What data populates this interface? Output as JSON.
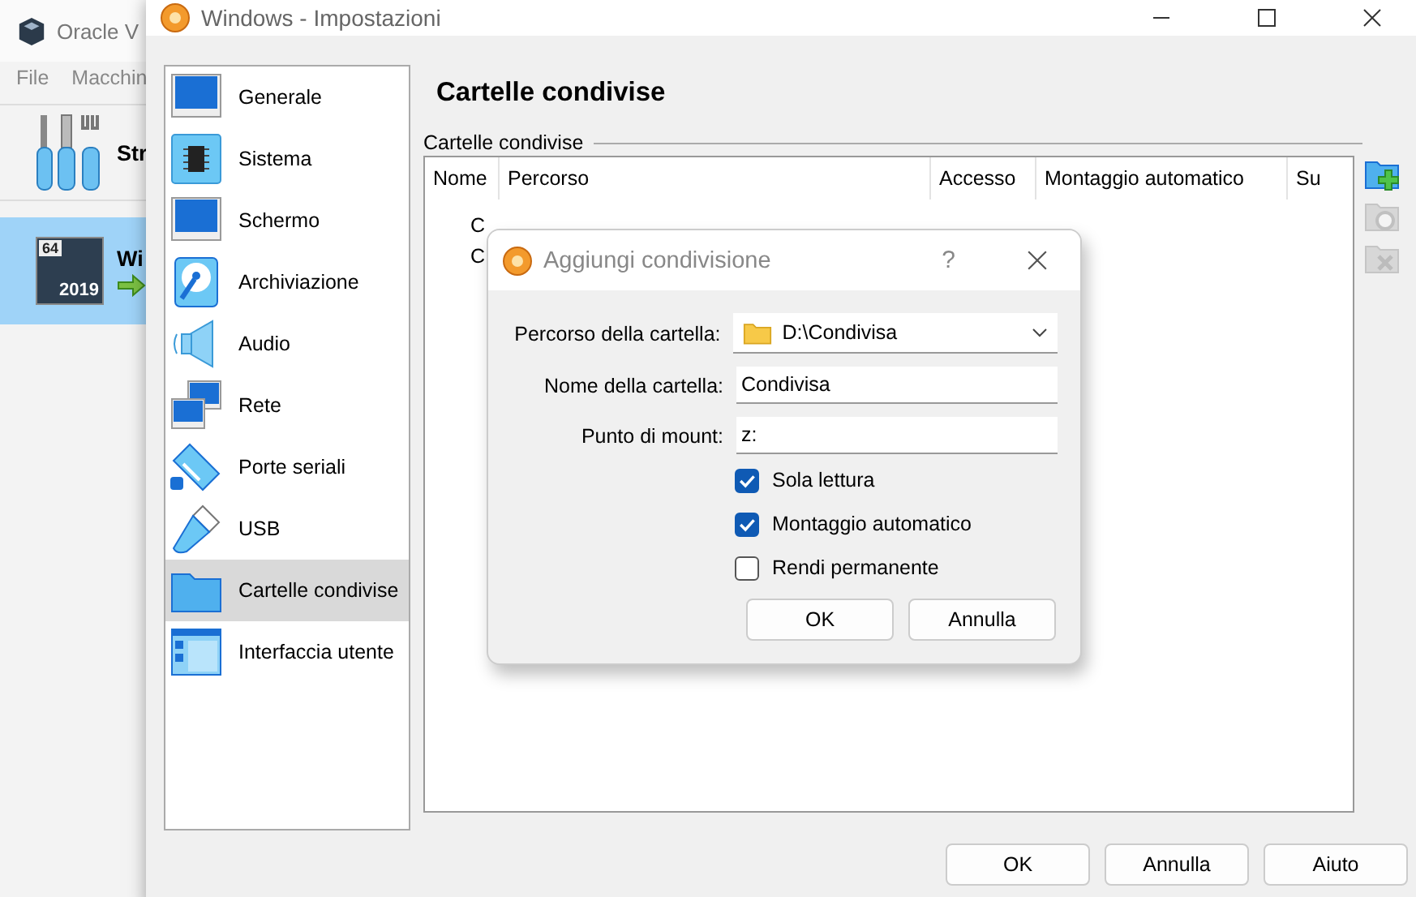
{
  "main_window": {
    "title": "Oracle V",
    "menu": [
      "File",
      "Macchin"
    ],
    "tools_label": "Str",
    "vms": [
      {
        "label": "Wi",
        "badge": "64",
        "year": "2019",
        "selected": true
      }
    ]
  },
  "settings": {
    "title": "Windows - Impostazioni",
    "sections": [
      {
        "label": "Generale",
        "kind": "monitor",
        "selected": false
      },
      {
        "label": "Sistema",
        "kind": "chip",
        "selected": false
      },
      {
        "label": "Schermo",
        "kind": "monitor",
        "selected": false
      },
      {
        "label": "Archiviazione",
        "kind": "disk",
        "selected": false
      },
      {
        "label": "Audio",
        "kind": "speaker",
        "selected": false
      },
      {
        "label": "Rete",
        "kind": "network",
        "selected": false
      },
      {
        "label": "Porte seriali",
        "kind": "serial",
        "selected": false
      },
      {
        "label": "USB",
        "kind": "usb",
        "selected": false
      },
      {
        "label": "Cartelle condivise",
        "kind": "folder",
        "selected": true
      },
      {
        "label": "Interfaccia utente",
        "kind": "ui",
        "selected": false
      }
    ],
    "heading": "Cartelle condivise",
    "group_label": "Cartelle condivise",
    "table": {
      "columns": [
        "Nome",
        "Percorso",
        "Accesso",
        "Montaggio automatico",
        "Su"
      ],
      "rows": [
        {
          "label": "C"
        },
        {
          "label": "C"
        }
      ]
    },
    "side_tools": [
      {
        "kind": "add",
        "disabled": false
      },
      {
        "kind": "edit",
        "disabled": true
      },
      {
        "kind": "remove",
        "disabled": true
      }
    ],
    "buttons": [
      "OK",
      "Annulla",
      "Aiuto"
    ]
  },
  "dialog": {
    "title": "Aggiungi condivisione",
    "help": "?",
    "fields": [
      {
        "kind": "combo",
        "label": "Percorso della cartella:",
        "value": "D:\\Condivisa"
      },
      {
        "kind": "text",
        "label": "Nome della cartella:",
        "value": "Condivisa"
      },
      {
        "kind": "text",
        "label": "Punto di mount:",
        "value": "z:"
      }
    ],
    "checkboxes": [
      {
        "label": "Sola lettura",
        "checked": true
      },
      {
        "label": "Montaggio automatico",
        "checked": true
      },
      {
        "label": "Rendi permanente",
        "checked": false
      }
    ],
    "buttons": [
      "OK",
      "Annulla"
    ]
  }
}
